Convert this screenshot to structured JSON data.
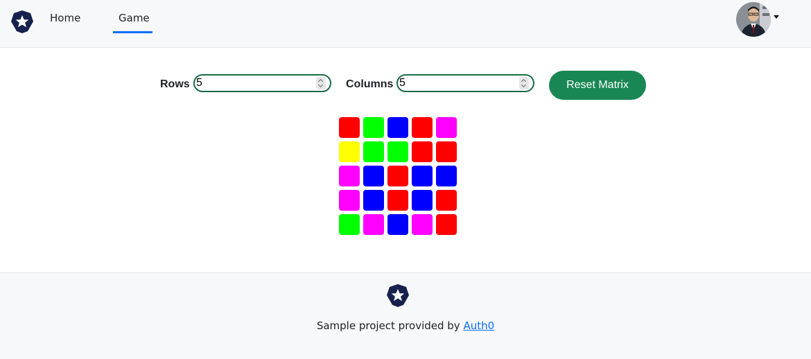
{
  "nav": {
    "home_label": "Home",
    "game_label": "Game",
    "active_tab": "Game",
    "logo_icon": "auth0-star-shield-icon",
    "avatar_icon": "user-avatar-photo",
    "caret_icon": "caret-down-icon"
  },
  "controls": {
    "rows_label": "Rows",
    "rows_value": "5",
    "columns_label": "Columns",
    "columns_value": "5",
    "reset_label": "Reset Matrix"
  },
  "matrix": {
    "rows": 5,
    "columns": 5,
    "cells": [
      [
        "red",
        "green",
        "blue",
        "red",
        "magenta"
      ],
      [
        "yellow",
        "green",
        "green",
        "red",
        "red"
      ],
      [
        "magenta",
        "blue",
        "red",
        "blue",
        "blue"
      ],
      [
        "magenta",
        "blue",
        "red",
        "blue",
        "red"
      ],
      [
        "green",
        "magenta",
        "blue",
        "magenta",
        "red"
      ]
    ]
  },
  "colors": {
    "red": "#ff0000",
    "green": "#00ff00",
    "blue": "#0000ff",
    "magenta": "#ff00ff",
    "yellow": "#ffff00",
    "accent": "#198754",
    "link": "#0d6efd",
    "logo": "#16214d"
  },
  "footer": {
    "text": "Sample project provided by ",
    "link_label": "Auth0",
    "logo_icon": "auth0-star-shield-icon"
  }
}
